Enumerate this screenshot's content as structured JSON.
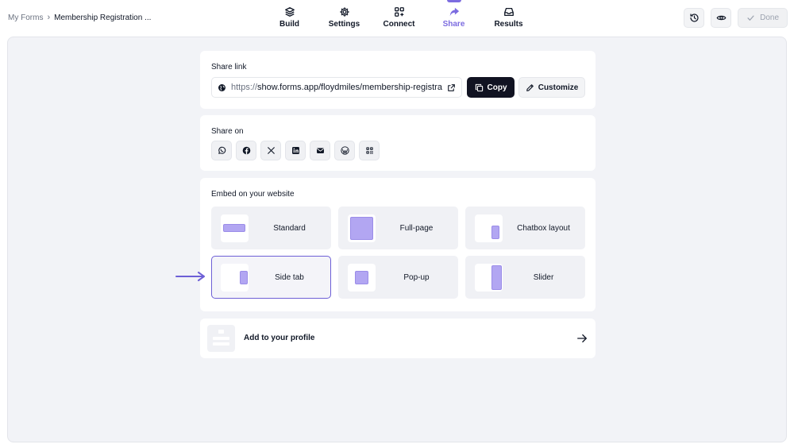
{
  "breadcrumb": {
    "root": "My Forms",
    "separator": "›",
    "current": "Membership Registration ..."
  },
  "nav": {
    "items": [
      {
        "label": "Build",
        "icon": "layers-icon",
        "active": false
      },
      {
        "label": "Settings",
        "icon": "gear-icon",
        "active": false
      },
      {
        "label": "Connect",
        "icon": "grid-plus-icon",
        "active": false
      },
      {
        "label": "Share",
        "icon": "share-arrow-icon",
        "active": true
      },
      {
        "label": "Results",
        "icon": "inbox-icon",
        "active": false
      }
    ]
  },
  "top_right": {
    "history_icon": "history-icon",
    "preview_icon": "eye-icon",
    "done_label": "Done"
  },
  "share_link": {
    "title": "Share link",
    "url_prefix": "https://",
    "url": "show.forms.app/floydmiles/membership-registration",
    "copy_label": "Copy",
    "customize_label": "Customize"
  },
  "share_on": {
    "title": "Share on",
    "icons": [
      "whatsapp-icon",
      "facebook-icon",
      "x-icon",
      "linkedin-icon",
      "email-icon",
      "wordpress-icon",
      "qr-code-icon"
    ]
  },
  "embed": {
    "title": "Embed on your website",
    "options": [
      {
        "label": "Standard",
        "selected": false
      },
      {
        "label": "Full-page",
        "selected": false
      },
      {
        "label": "Chatbox layout",
        "selected": false
      },
      {
        "label": "Side tab",
        "selected": true
      },
      {
        "label": "Pop-up",
        "selected": false
      },
      {
        "label": "Slider",
        "selected": false
      }
    ]
  },
  "profile": {
    "label": "Add to your profile"
  },
  "colors": {
    "accent": "#7c6ce0",
    "selected_border": "#6d5fd6",
    "thumb_fill": "#b2a6f2",
    "copy_bg": "#111322",
    "canvas_bg": "#f2f3f7"
  }
}
